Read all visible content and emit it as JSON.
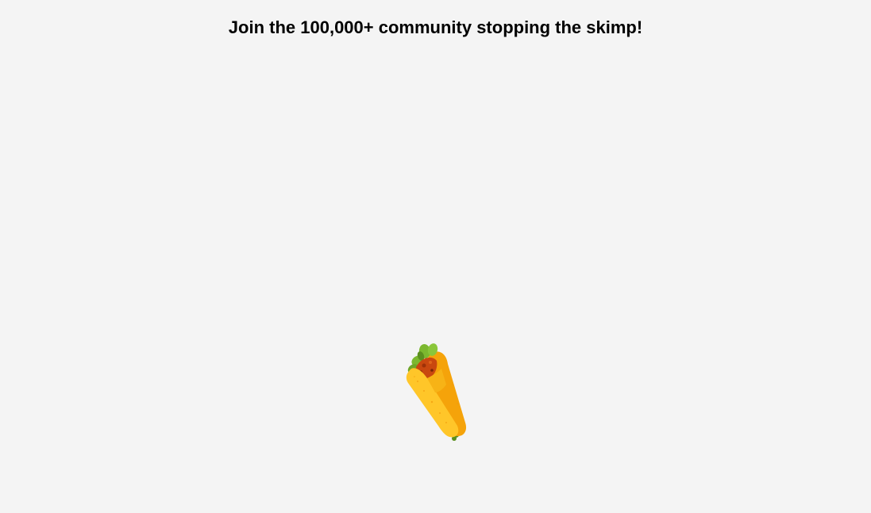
{
  "page": {
    "heading": "Join the 100,000+ community stopping the skimp!",
    "background_color": "#f4f4f4"
  },
  "illustration": {
    "icon": "burrito-icon",
    "colors": {
      "tortilla_light": "#ffc629",
      "tortilla_dark": "#f5a30a",
      "lettuce": "#7cb82f",
      "lettuce_dark": "#5b8f1e",
      "filling": "#c9480f",
      "filling_dark": "#9e3208"
    }
  }
}
